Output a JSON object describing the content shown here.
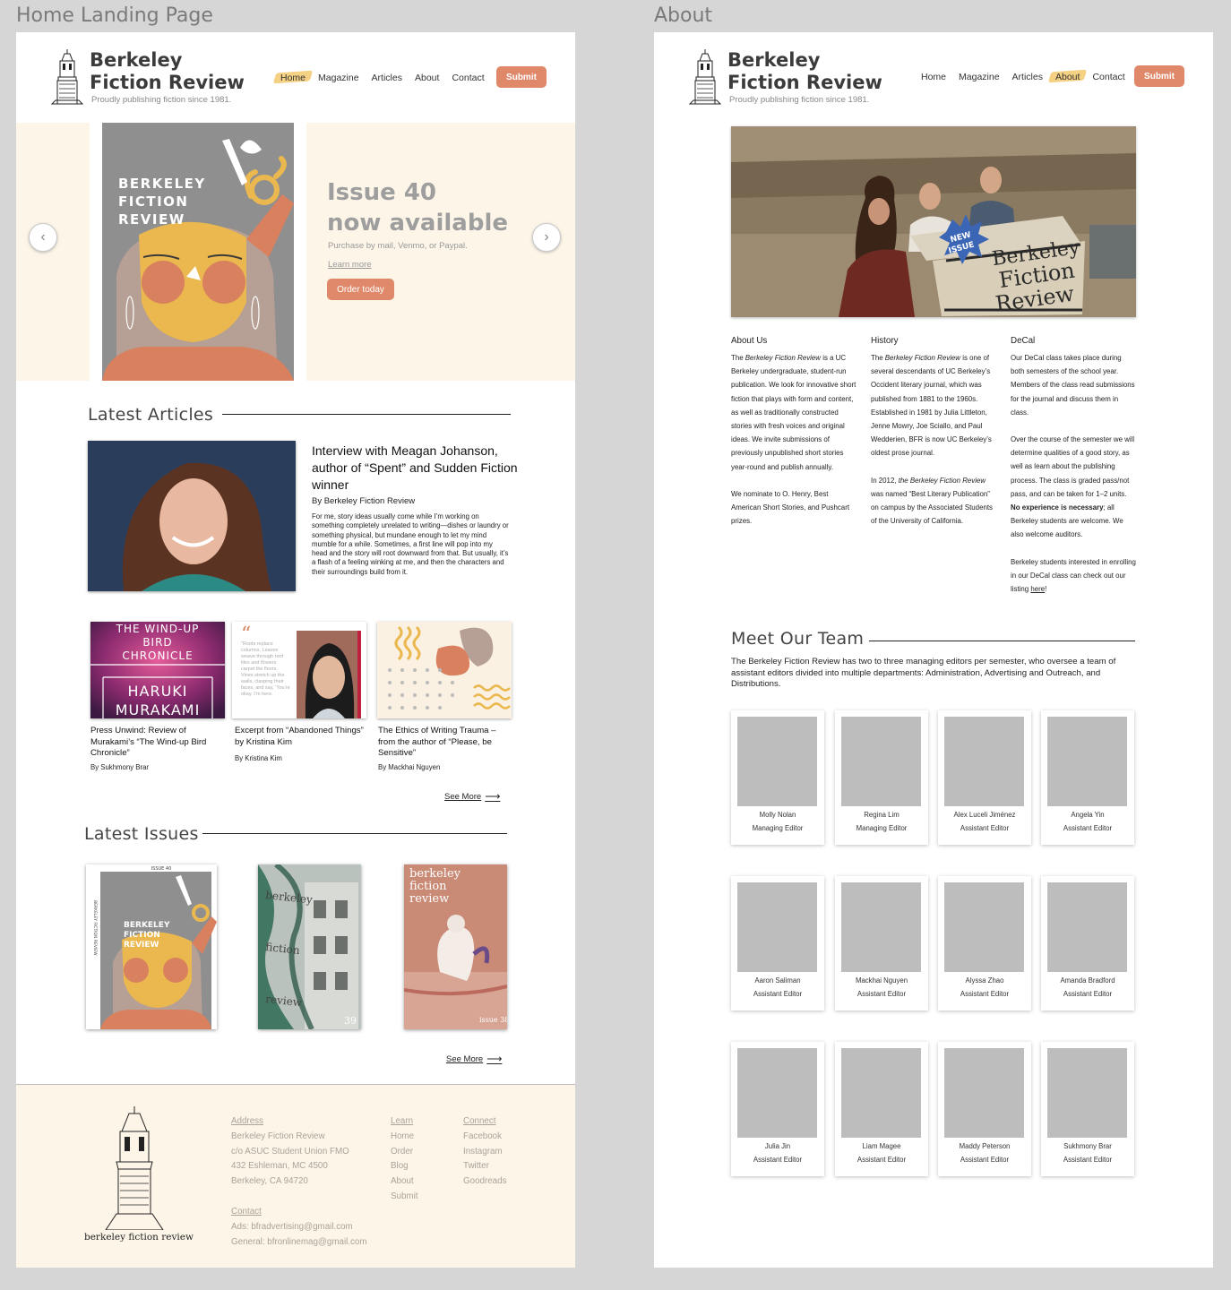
{
  "frames": {
    "home_label": "Home Landing Page",
    "about_label": "About"
  },
  "brand": {
    "line1": "Berkeley",
    "line2": "Fiction Review",
    "tagline": "Proudly publishing fiction since 1981."
  },
  "nav": {
    "home": "Home",
    "magazine": "Magazine",
    "articles": "Articles",
    "about": "About",
    "contact": "Contact",
    "submit": "Submit"
  },
  "hero": {
    "cover_text": [
      "BERKELEY",
      "FICTION",
      "REVIEW"
    ],
    "title_line1": "Issue 40",
    "title_line2": "now available",
    "subtitle": "Purchase by mail, Venmo, or Paypal.",
    "learn_more": "Learn more",
    "order_button": "Order today"
  },
  "latest_articles": {
    "heading": "Latest Articles",
    "feature": {
      "title": "Interview with Meagan Johanson, author of “Spent” and Sudden Fiction winner",
      "byline": "By Berkeley Fiction Review",
      "excerpt": "For me, story ideas usually come while I’m working on something completely unrelated to writing—dishes or laundry or something physical, but mundane enough to let my mind mumble for a while. Sometimes, a first line will pop into my head and the story will root downward from that. But usually, it’s a flash of a feeling winking at me, and then the characters and their surroundings build from it."
    },
    "cards": [
      {
        "title": "Press Unwind: Review of Murakami’s “The Wind-up Bird Chronicle”",
        "byline": "By Sukhmony Brar",
        "image_text": [
          "THE WIND-UP",
          "BIRD",
          "CHRONICLE",
          "HARUKI",
          "MURAKAMI"
        ]
      },
      {
        "title": "Excerpt from “Abandoned Things” by Kristina Kim",
        "byline": "By Kristina Kim",
        "image_quote": "“Roots replace columns. Leaves weave through roof tiles and flowers carpet the floors. Vines stretch up the walls, clasping their faces, and say, ‘You’re okay. I’m here."
      },
      {
        "title": "The Ethics of Writing Trauma – from the author of “Please, be Sensitive”",
        "byline": "By Mackhai Nguyen"
      }
    ],
    "see_more": "See More"
  },
  "latest_issues": {
    "heading": "Latest Issues",
    "issues": [
      {
        "top_label": "ISSUE 40",
        "spine": "BERKELEY FICTION REVIEW",
        "cover_text": [
          "BERKELEY",
          "FICTION",
          "REVIEW"
        ]
      },
      {
        "words": [
          "berkeley",
          "fiction",
          "review"
        ],
        "number": "39"
      },
      {
        "words": [
          "berkeley",
          "fiction",
          "review"
        ],
        "number": "issue 38"
      }
    ],
    "see_more": "See More"
  },
  "footer": {
    "brand_text": "berkeley fiction review",
    "address": {
      "heading": "Address",
      "lines": [
        "Berkeley Fiction Review",
        "c/o ASUC Student Union FMO",
        "432 Eshleman, MC 4500",
        "Berkeley, CA 94720"
      ]
    },
    "contact": {
      "heading": "Contact",
      "lines": [
        "Ads: bfradvertising@gmail.com",
        "General: bfronlinemag@gmail.com"
      ]
    },
    "learn": {
      "heading": "Learn",
      "links": [
        "Home",
        "Order",
        "Blog",
        "About",
        "Submit"
      ]
    },
    "connect": {
      "heading": "Connect",
      "links": [
        "Facebook",
        "Instagram",
        "Twitter",
        "Goodreads"
      ]
    }
  },
  "about": {
    "photo_sign": [
      "Berkeley",
      "Fiction",
      "Review"
    ],
    "photo_badge": [
      "NEW",
      "ISSUE"
    ],
    "about_us": {
      "heading": "About Us",
      "p1_pre": "The ",
      "p1_em": "Berkeley Fiction Review",
      "p1_post": " is a UC Berkeley undergraduate, student-run publication. We look for innovative short fiction that plays with form and content, as well as traditionally constructed stories with fresh voices and original ideas. We invite submissions of previously unpublished short stories year-round and publish annually.",
      "p2": "We nominate to O. Henry, Best American Short Stories, and Pushcart prizes."
    },
    "history": {
      "heading": "History",
      "p1_pre": "The ",
      "p1_em": "Berkeley Fiction Review",
      "p1_post": " is one of several descendants of UC Berkeley’s Occident literary journal, which was published from 1881 to the 1960s. Established in 1981 by Julia Littleton, Jenne Mowry, Joe Sciallo, and Paul Wedderien, BFR is now UC Berkeley’s oldest prose journal.",
      "p2_pre": "In 2012, ",
      "p2_em": "the Berkeley Fiction Review",
      "p2_post": " was named “Best Literary Publication” on campus by the Associated Students of the University of California."
    },
    "decal": {
      "heading": "DeCal",
      "p1": "Our DeCal class takes place during both semesters of the school year. Members of the class read submissions for the journal and discuss them in class.",
      "p2_pre": "Over the course of the semester we will determine qualities of a good story, as well as learn about the publishing process. The class is graded pass/not pass, and can be taken for 1–2 units. ",
      "p2_bold": "No experience is necessary",
      "p2_post": "; all Berkeley students are welcome. We also welcome auditors.",
      "p3_pre": "Berkeley students interested in enrolling in our DeCal class can check out our listing ",
      "p3_link": "here",
      "p3_post": "!"
    },
    "team": {
      "heading": "Meet Our Team",
      "intro": "The Berkeley Fiction Review has two to three managing editors per semester, who oversee a team of assistant editors divided into multiple departments: Administration, Advertising and Outreach, and Distributions.",
      "members": [
        {
          "name": "Molly Nolan",
          "role": "Managing Editor"
        },
        {
          "name": "Regina Lim",
          "role": "Managing Editor"
        },
        {
          "name": "Alex Luceli Jiménez",
          "role": "Assistant Editor"
        },
        {
          "name": "Angela Yin",
          "role": "Assistant Editor"
        },
        {
          "name": "Aaron Saliman",
          "role": "Assistant Editor"
        },
        {
          "name": "Mackhai Nguyen",
          "role": "Assistant Editor"
        },
        {
          "name": "Alyssa Zhao",
          "role": "Assistant Editor"
        },
        {
          "name": "Amanda Bradford",
          "role": "Assistant Editor"
        },
        {
          "name": "Julia Jin",
          "role": "Assistant Editor"
        },
        {
          "name": "Liam Magee",
          "role": "Assistant Editor"
        },
        {
          "name": "Maddy Peterson",
          "role": "Assistant Editor"
        },
        {
          "name": "Sukhmony Brar",
          "role": "Assistant Editor"
        }
      ]
    }
  },
  "colors": {
    "accent": "#e0896a",
    "highlight": "#f1c25a",
    "cream": "#fcf5e8",
    "cover_gray": "#8f8f8f",
    "cover_yellow": "#eab84e"
  }
}
